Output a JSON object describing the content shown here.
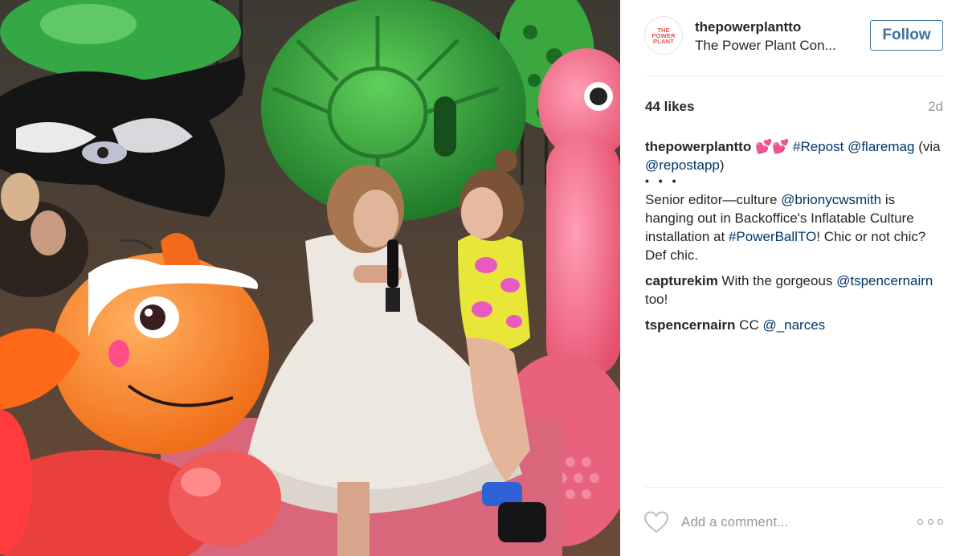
{
  "post": {
    "photo_alt": "Two women sitting among giant inflatable animals",
    "author": {
      "avatar_text": "THE POWER PLANT",
      "username": "thepowerplantto",
      "location": "The Power Plant Con..."
    },
    "follow_label": "Follow",
    "likes": "44 likes",
    "time_ago": "2d",
    "comments": [
      {
        "user": "thepowerplantto",
        "parts": [
          {
            "t": " 💕💕 ",
            "link": false
          },
          {
            "t": "#Repost",
            "link": true
          },
          {
            "t": " ",
            "link": false
          },
          {
            "t": "@flaremag",
            "link": true
          },
          {
            "t": " (via ",
            "link": false
          },
          {
            "t": "@repostapp",
            "link": true
          },
          {
            "t": ")",
            "link": false
          }
        ],
        "dots": "• • •",
        "body_parts": [
          {
            "t": "Senior editor—culture ",
            "link": false
          },
          {
            "t": "@brionycwsmith",
            "link": true
          },
          {
            "t": " is hanging out in Backoffice's Inflatable Culture installation at ",
            "link": false
          },
          {
            "t": "#PowerBallTO",
            "link": true
          },
          {
            "t": "! Chic or not chic? Def chic.",
            "link": false
          }
        ]
      },
      {
        "user": "capturekim",
        "parts": [
          {
            "t": " With the gorgeous ",
            "link": false
          },
          {
            "t": "@tspencernairn",
            "link": true
          },
          {
            "t": " too!",
            "link": false
          }
        ]
      },
      {
        "user": "tspencernairn",
        "parts": [
          {
            "t": " CC ",
            "link": false
          },
          {
            "t": "@_narces",
            "link": true
          }
        ]
      }
    ],
    "comment_placeholder": "Add a comment...",
    "icons": {
      "like": "heart-outline-icon",
      "more": "more-options-icon"
    }
  }
}
